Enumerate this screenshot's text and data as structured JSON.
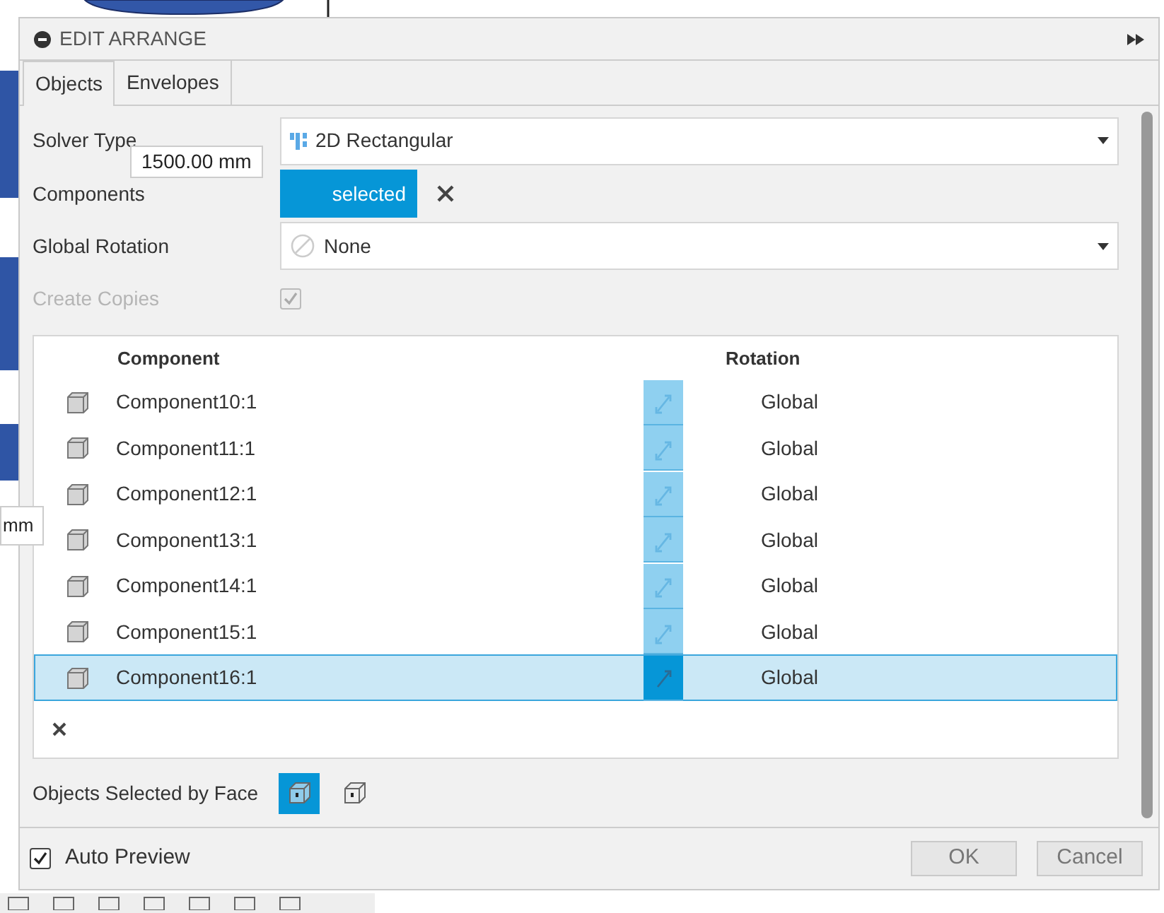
{
  "dialog": {
    "title": "EDIT ARRANGE",
    "tabs": [
      {
        "label": "Objects",
        "selected": true
      },
      {
        "label": "Envelopes",
        "selected": false
      }
    ],
    "fields": [
      {
        "kind": "dropdown",
        "label": "Solver Type",
        "value": "2D Rectangular"
      },
      {
        "kind": "selection",
        "label": "Components",
        "value": "selected"
      },
      {
        "kind": "dropdown",
        "label": "Global Rotation",
        "value": "None"
      },
      {
        "kind": "checkbox",
        "label": "Create Copies",
        "checked": true,
        "disabled": true
      }
    ],
    "table": {
      "columns": [
        "Component",
        "Rotation"
      ],
      "rows": [
        {
          "component": "Component10:1",
          "rotation": "Global",
          "selected": false
        },
        {
          "component": "Component11:1",
          "rotation": "Global",
          "selected": false
        },
        {
          "component": "Component12:1",
          "rotation": "Global",
          "selected": false
        },
        {
          "component": "Component13:1",
          "rotation": "Global",
          "selected": false
        },
        {
          "component": "Component14:1",
          "rotation": "Global",
          "selected": false
        },
        {
          "component": "Component15:1",
          "rotation": "Global",
          "selected": false
        },
        {
          "component": "Component16:1",
          "rotation": "Global",
          "selected": true
        }
      ]
    },
    "face_selection": {
      "label": "Objects Selected by Face",
      "options": [
        {
          "selected": true
        },
        {
          "selected": false
        }
      ]
    },
    "auto_preview": {
      "label": "Auto Preview",
      "checked": true
    },
    "buttons": [
      "OK",
      "Cancel"
    ]
  },
  "tooltips": [
    "1500.00 mm",
    "mm"
  ]
}
